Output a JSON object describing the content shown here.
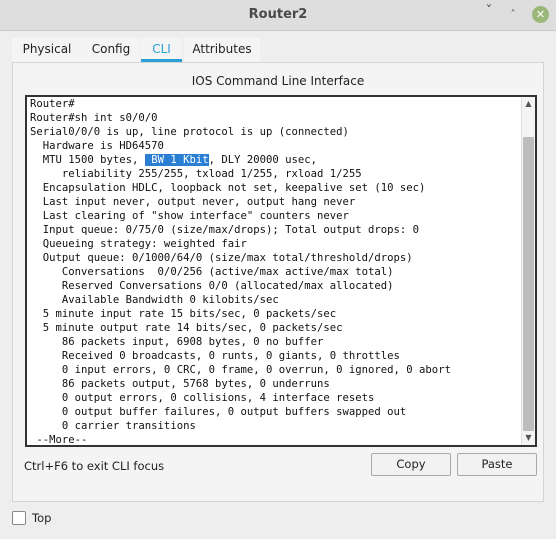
{
  "window": {
    "title": "Router2",
    "minimize_glyph": "ˇ",
    "maximize_glyph": "˄",
    "close_glyph": "✕"
  },
  "tabs": [
    {
      "label": "Physical",
      "active": false
    },
    {
      "label": "Config",
      "active": false
    },
    {
      "label": "CLI",
      "active": true
    },
    {
      "label": "Attributes",
      "active": false
    }
  ],
  "cli": {
    "title": "IOS Command Line Interface",
    "lines": [
      "Router#",
      "Router#sh int s0/0/0",
      "Serial0/0/0 is up, line protocol is up (connected)",
      "  Hardware is HD64570",
      "  MTU 1500 bytes, ",
      "     reliability 255/255, txload 1/255, rxload 1/255",
      "  Encapsulation HDLC, loopback not set, keepalive set (10 sec)",
      "  Last input never, output never, output hang never",
      "  Last clearing of \"show interface\" counters never",
      "  Input queue: 0/75/0 (size/max/drops); Total output drops: 0",
      "  Queueing strategy: weighted fair",
      "  Output queue: 0/1000/64/0 (size/max total/threshold/drops)",
      "     Conversations  0/0/256 (active/max active/max total)",
      "     Reserved Conversations 0/0 (allocated/max allocated)",
      "     Available Bandwidth 0 kilobits/sec",
      "  5 minute input rate 15 bits/sec, 0 packets/sec",
      "  5 minute output rate 14 bits/sec, 0 packets/sec",
      "     86 packets input, 6908 bytes, 0 no buffer",
      "     Received 0 broadcasts, 0 runts, 0 giants, 0 throttles",
      "     0 input errors, 0 CRC, 0 frame, 0 overrun, 0 ignored, 0 abort",
      "     86 packets output, 5768 bytes, 0 underruns",
      "     0 output errors, 0 collisions, 4 interface resets",
      "     0 output buffer failures, 0 output buffers swapped out",
      "     0 carrier transitions",
      " --More--"
    ],
    "mtu_highlight": " BW 1 Kbit",
    "mtu_suffix": ", DLY 20000 usec,",
    "scroll_position": 1.0,
    "scroll_visible_fraction": 0.92,
    "scroll_up_glyph": "▲",
    "scroll_down_glyph": "▼",
    "hint": "Ctrl+F6 to exit CLI focus",
    "copy_label": "Copy",
    "paste_label": "Paste"
  },
  "footer": {
    "top_label": "Top",
    "top_checked": false
  },
  "colors": {
    "accent": "#2a9fd6",
    "selection": "#2a7fd4",
    "close_button": "#9ab87a"
  }
}
